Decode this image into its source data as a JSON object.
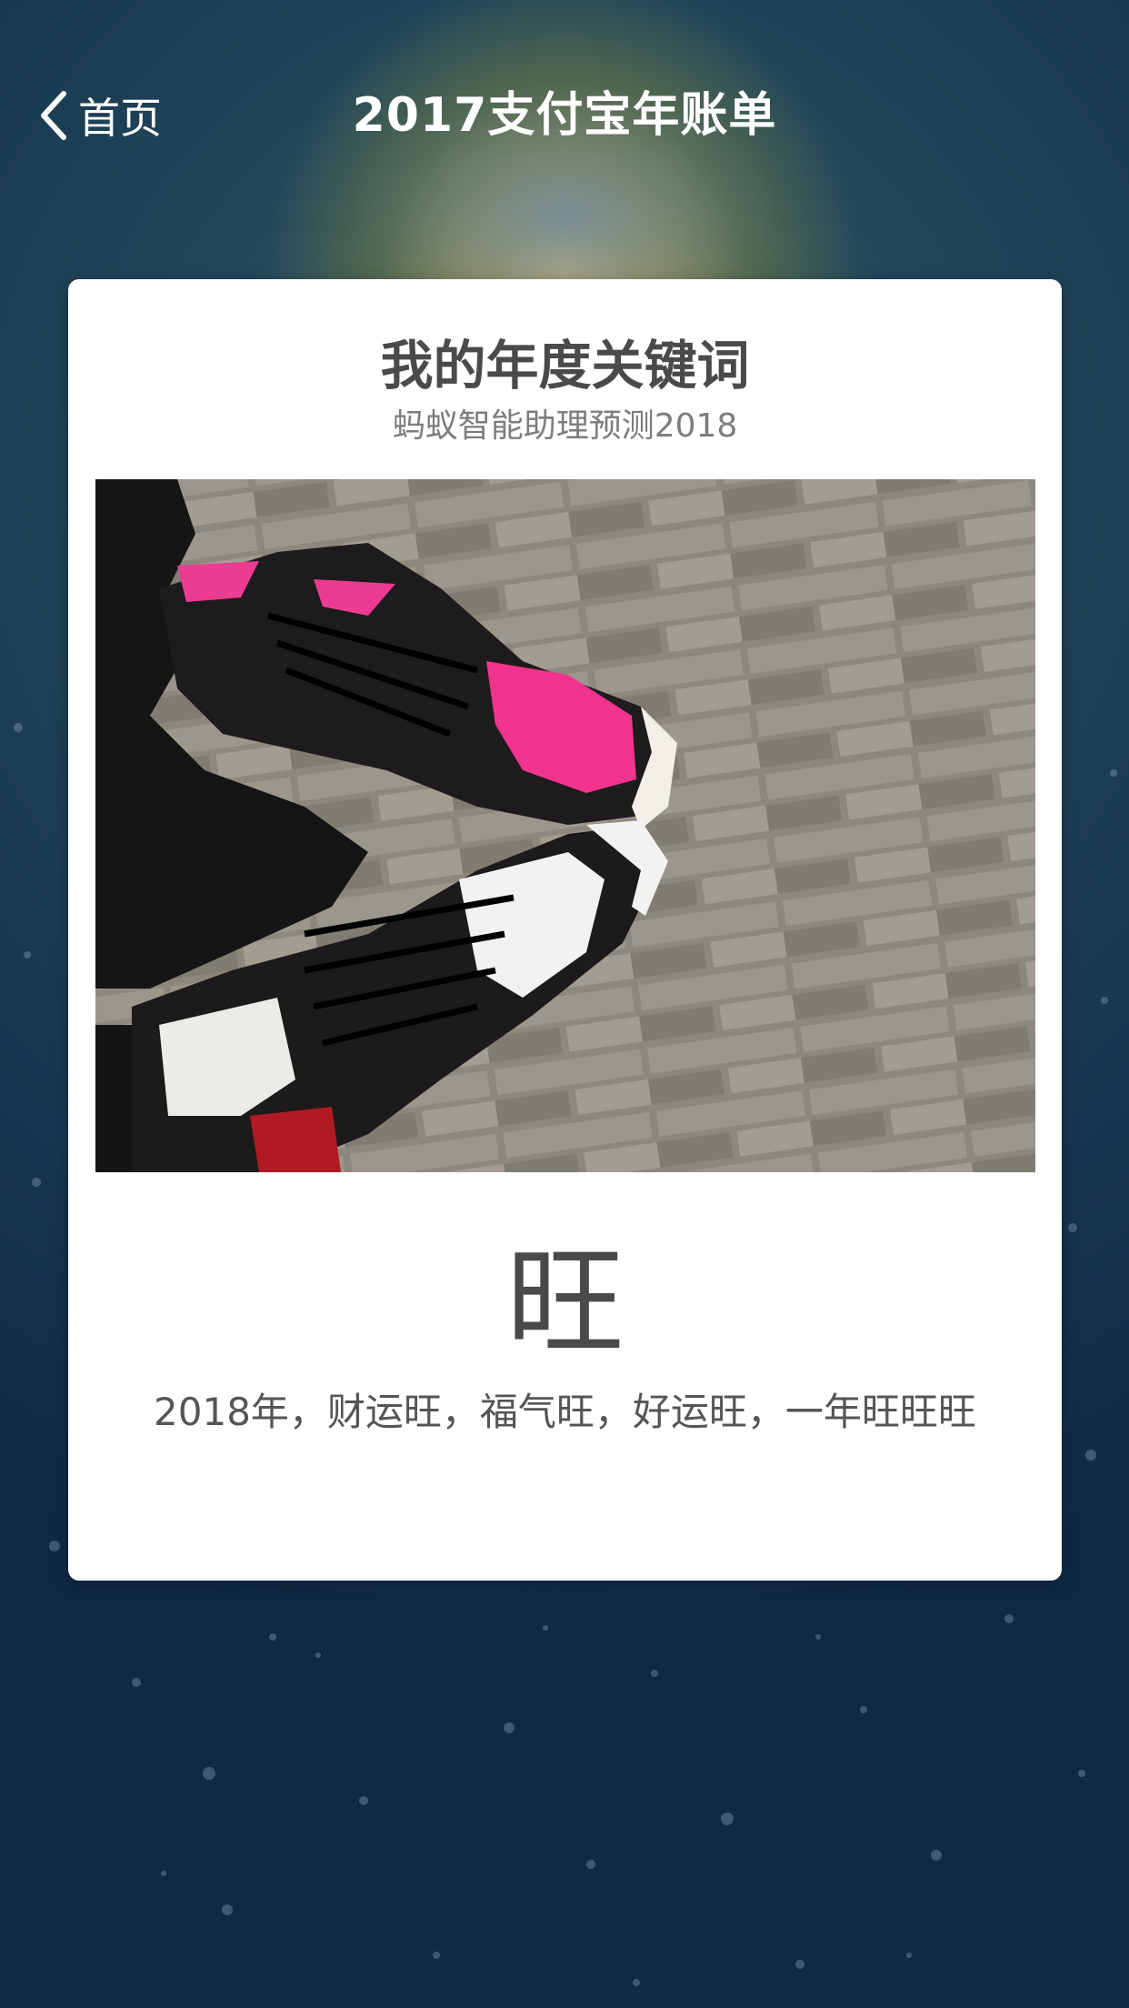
{
  "nav": {
    "back_label": "首页",
    "title": "2017支付宝年账单"
  },
  "card": {
    "title": "我的年度关键词",
    "subtitle": "蚂蚁智能助理预测2018",
    "keyword": "旺",
    "description": "2018年，财运旺，福气旺，好运旺，一年旺旺旺"
  },
  "icons": {
    "back": "chevron-left-icon"
  },
  "colors": {
    "card_bg": "#ffffff",
    "title_text": "#4a4a4a",
    "subtitle_text": "#7d7d7d",
    "nav_text": "#ffffff"
  }
}
